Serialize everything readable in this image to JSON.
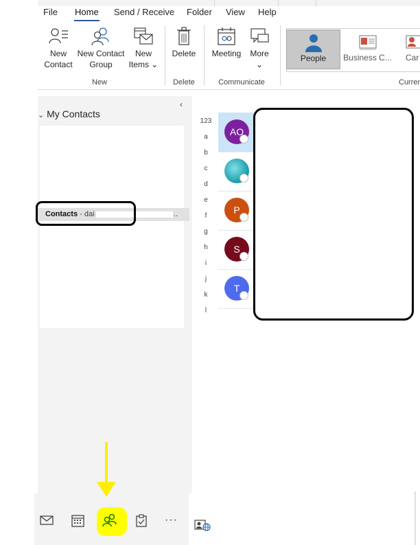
{
  "menu": [
    "File",
    "Home",
    "Send / Receive",
    "Folder",
    "View",
    "Help"
  ],
  "active_menu": "Home",
  "ribbon": {
    "new_contact": [
      "New",
      "Contact"
    ],
    "new_contact_group": [
      "New Contact",
      "Group"
    ],
    "new_items": [
      "New",
      "Items ⌄"
    ],
    "group_new": "New",
    "delete": "Delete",
    "group_delete": "Delete",
    "meeting": "Meeting",
    "more": "More",
    "more_chevron": "⌄",
    "group_communicate": "Communicate",
    "view_people": "People",
    "view_business": "Business C...",
    "view_card": "Car",
    "group_current": "Curren"
  },
  "folder_pane": {
    "header": "My Contacts",
    "collapse_glyph": "‹",
    "header_chevron": "⌄",
    "folder_name": "Contacts",
    "folder_suffix": " - dai",
    "folder_ellipsis": ".."
  },
  "index": [
    "123",
    "a",
    "b",
    "c",
    "d",
    "e",
    "f",
    "g",
    "h",
    "i",
    "j",
    "k",
    "l"
  ],
  "contacts": [
    {
      "initials": "AO",
      "color": "#7d1fa0",
      "selected": true
    },
    {
      "initials": "",
      "color": "#3fb7c5",
      "selected": false
    },
    {
      "initials": "P",
      "color": "#ca5010",
      "selected": false
    },
    {
      "initials": "S",
      "color": "#750b1c",
      "selected": false
    },
    {
      "initials": "T",
      "color": "#4f6bed",
      "selected": false
    }
  ],
  "nav": {
    "more_glyph": "···"
  },
  "annotation": {
    "arrow_color": "#ffee00",
    "highlight_color": "#ffff00"
  }
}
